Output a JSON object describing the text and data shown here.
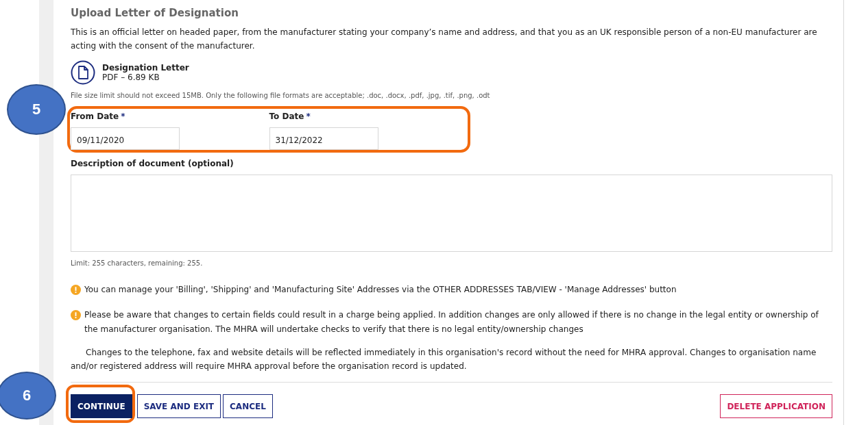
{
  "section": {
    "title": "Upload Letter of Designation",
    "description": "This is an official letter on headed paper, from the manufacturer stating your company’s name and address, and that you as an UK responsible person of a non-EU manufacturer are acting with the consent of the manufacturer."
  },
  "file": {
    "name": "Designation Letter",
    "meta": "PDF – 6.89 KB"
  },
  "file_note": "File size limit should not exceed 15MB. Only the following file formats are acceptable; .doc, .docx, .pdf, .jpg, .tif, .png, .odt",
  "dates": {
    "callout": "5",
    "fields": [
      {
        "label": "From Date",
        "required_mark": "*",
        "value": "09/11/2020"
      },
      {
        "label": "To Date",
        "required_mark": "*",
        "value": "31/12/2022"
      }
    ]
  },
  "description_field": {
    "label": "Description of document (optional)",
    "limit": "Limit: 255 characters, remaining: 255."
  },
  "notes": [
    {
      "kind": "warning",
      "text": "You can manage your 'Billing', 'Shipping' and 'Manufacturing Site' Addresses via the OTHER ADDRESSES TAB/VIEW - 'Manage Addresses' button"
    },
    {
      "kind": "warning",
      "text": "Please be aware that changes to certain fields could result in a charge being applied. In addition changes are only allowed if there is no change in the legal entity or ownership of the manufacturer organisation. The MHRA will undertake checks to verify that there is no legal entity/ownership changes"
    },
    {
      "kind": "plain",
      "text": "Changes to the telephone, fax and website details will be reflected immediately in this organisation's record without the need for MHRA approval. Changes to organisation name and/or registered address will require MHRA approval before the organisation record is updated."
    }
  ],
  "actions": {
    "callout": "6",
    "buttons": [
      {
        "label": "CONTINUE",
        "kind": "primary"
      },
      {
        "label": "SAVE AND EXIT",
        "kind": "outline"
      },
      {
        "label": "CANCEL",
        "kind": "outline"
      },
      {
        "label": "DELETE APPLICATION",
        "kind": "danger"
      }
    ]
  }
}
